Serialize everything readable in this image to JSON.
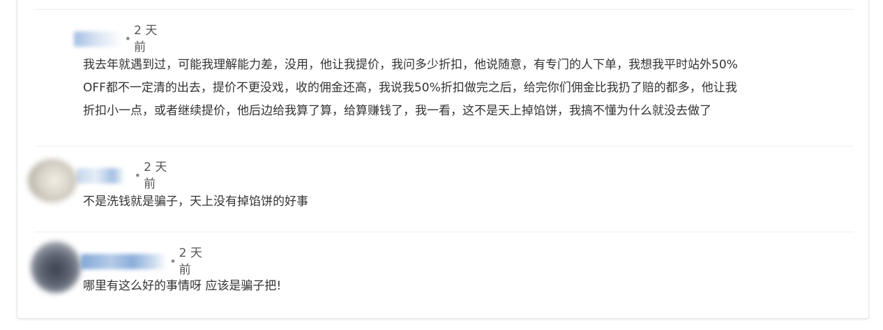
{
  "colors": {
    "text": "#333333",
    "meta": "#555555",
    "divider": "#eeeeee",
    "blur_blue": "#3d77c2"
  },
  "comments": [
    {
      "time": "2 天前",
      "lines": [
        "我去年就遇到过，可能我理解能力差，没用，他让我提价，我问多少折扣，他说随意，有专门的人下单，我想我平时站外50%",
        "OFF都不一定清的出去，提价不更没戏，收的佣金还高，我说我50%折扣做完之后，给完你们佣金比我扔了赔的都多，他让我",
        "折扣小一点，或者继续提价，他后边给我算了算，给算赚钱了，我一看，这不是天上掉馅饼，我搞不懂为什么就没去做了"
      ]
    },
    {
      "time": "2 天前",
      "lines": [
        "不是洗钱就是骗子，天上没有掉馅饼的好事"
      ]
    },
    {
      "time": "2 天前",
      "lines": [
        "哪里有这么好的事情呀 应该是骗子把!"
      ]
    }
  ]
}
